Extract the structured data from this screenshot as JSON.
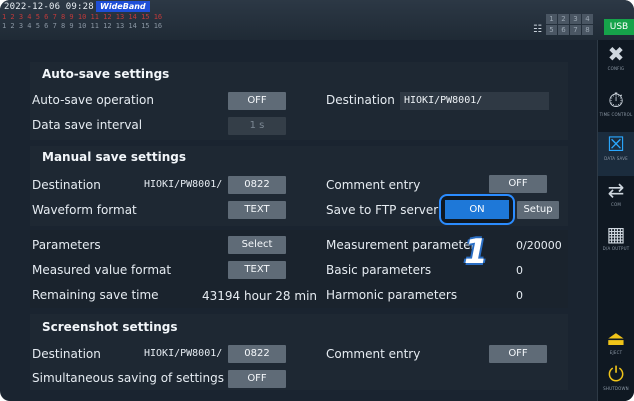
{
  "status_bar": {
    "datetime": "2022-12-06 09:28:14",
    "wideband_label": "WideBand",
    "channel_row1": "1 2 3 4 5 6 7 8 9 10 11 12 13 14 15 16",
    "channel_row2": "1 2 3 4 5 6 7 8 9 10 11 12 13 14 15 16",
    "indicator_cells": [
      "1",
      "2",
      "3",
      "4",
      "5",
      "6",
      "7",
      "8"
    ],
    "usb_label": "USB"
  },
  "sidebar": {
    "items": [
      {
        "label": "CONFIG",
        "icon": "wrench-screwdriver-icon"
      },
      {
        "label": "TIME CONTROL",
        "icon": "stopwatch-icon"
      },
      {
        "label": "DATA SAVE",
        "icon": "data-save-icon",
        "active": true
      },
      {
        "label": "COM",
        "icon": "com-icon"
      },
      {
        "label": "D/A OUTPUT",
        "icon": "da-output-icon"
      },
      {
        "label": "EJECT",
        "icon": "eject-icon"
      },
      {
        "label": "SHUTDOWN",
        "icon": "shutdown-icon"
      }
    ]
  },
  "auto_save": {
    "title": "Auto-save settings",
    "operation_label": "Auto-save operation",
    "operation_value": "OFF",
    "destination_label": "Destination",
    "destination_value": "HIOKI/PW8001/",
    "interval_label": "Data save interval",
    "interval_value": "1 s"
  },
  "manual_save": {
    "title": "Manual save settings",
    "destination_label": "Destination",
    "destination_path": "HIOKI/PW8001/",
    "destination_folder": "0822",
    "comment_label": "Comment entry",
    "comment_value": "OFF",
    "waveform_label": "Waveform format",
    "waveform_value": "TEXT",
    "ftp_label": "Save to FTP server",
    "ftp_value": "ON",
    "ftp_setup": "Setup"
  },
  "params_section": {
    "parameters_label": "Parameters",
    "parameters_btn": "Select",
    "measured_format_label": "Measured value format",
    "measured_format_value": "TEXT",
    "remaining_label": "Remaining save time",
    "remaining_value": "43194 hour 28 min",
    "measurement_params_label": "Measurement parameters",
    "measurement_params_value": "0/20000",
    "basic_params_label": "Basic parameters",
    "basic_params_value": "0",
    "harmonic_params_label": "Harmonic parameters",
    "harmonic_params_value": "0"
  },
  "screenshot": {
    "title": "Screenshot settings",
    "destination_label": "Destination",
    "destination_path": "HIOKI/PW8001/",
    "destination_folder": "0822",
    "comment_label": "Comment entry",
    "comment_value": "OFF",
    "simultaneous_label": "Simultaneous saving of settings",
    "simultaneous_value": "OFF"
  },
  "callout_number": "1",
  "colors": {
    "background": "#1a2430",
    "accent": "#1e78d8",
    "usb_green": "#16a34a",
    "wideband_blue": "#1f4fd8"
  }
}
